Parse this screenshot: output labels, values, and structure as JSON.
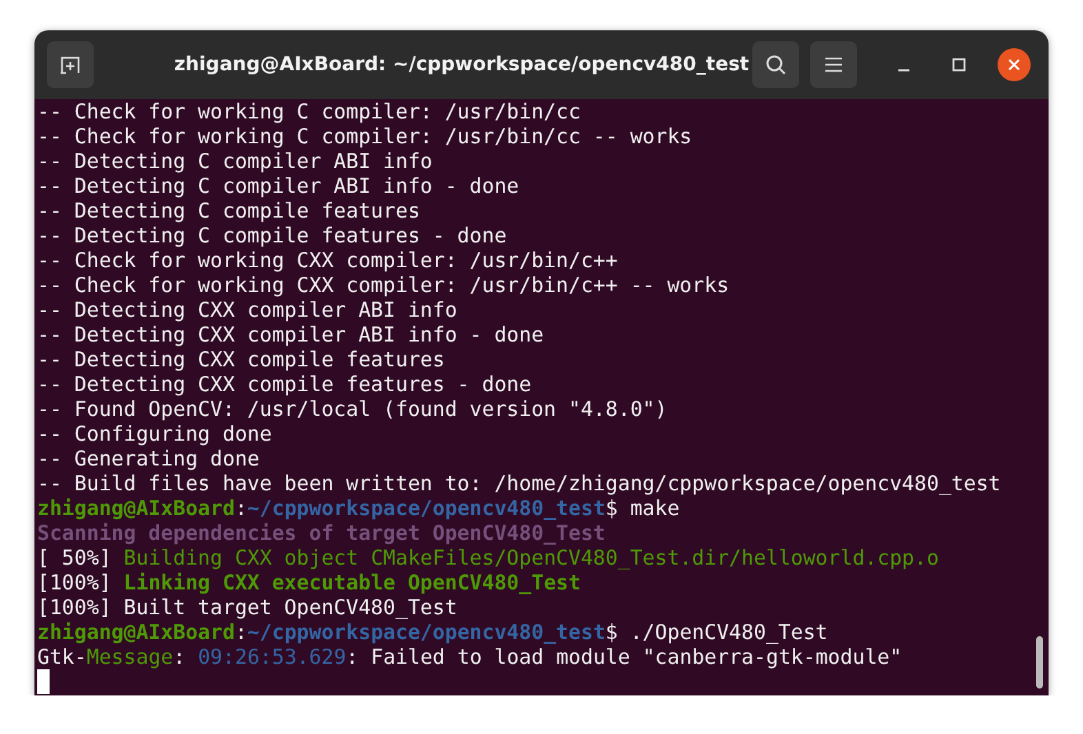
{
  "window": {
    "title": "zhigang@AIxBoard: ~/cppworkspace/opencv480_test"
  },
  "terminal": {
    "lines": [
      {
        "segments": [
          {
            "kind": "plain",
            "text": "-- Check for working C compiler: /usr/bin/cc"
          }
        ]
      },
      {
        "segments": [
          {
            "kind": "plain",
            "text": "-- Check for working C compiler: /usr/bin/cc -- works"
          }
        ]
      },
      {
        "segments": [
          {
            "kind": "plain",
            "text": "-- Detecting C compiler ABI info"
          }
        ]
      },
      {
        "segments": [
          {
            "kind": "plain",
            "text": "-- Detecting C compiler ABI info - done"
          }
        ]
      },
      {
        "segments": [
          {
            "kind": "plain",
            "text": "-- Detecting C compile features"
          }
        ]
      },
      {
        "segments": [
          {
            "kind": "plain",
            "text": "-- Detecting C compile features - done"
          }
        ]
      },
      {
        "segments": [
          {
            "kind": "plain",
            "text": "-- Check for working CXX compiler: /usr/bin/c++"
          }
        ]
      },
      {
        "segments": [
          {
            "kind": "plain",
            "text": "-- Check for working CXX compiler: /usr/bin/c++ -- works"
          }
        ]
      },
      {
        "segments": [
          {
            "kind": "plain",
            "text": "-- Detecting CXX compiler ABI info"
          }
        ]
      },
      {
        "segments": [
          {
            "kind": "plain",
            "text": "-- Detecting CXX compiler ABI info - done"
          }
        ]
      },
      {
        "segments": [
          {
            "kind": "plain",
            "text": "-- Detecting CXX compile features"
          }
        ]
      },
      {
        "segments": [
          {
            "kind": "plain",
            "text": "-- Detecting CXX compile features - done"
          }
        ]
      },
      {
        "segments": [
          {
            "kind": "plain",
            "text": "-- Found OpenCV: /usr/local (found version \"4.8.0\")"
          }
        ]
      },
      {
        "segments": [
          {
            "kind": "plain",
            "text": "-- Configuring done"
          }
        ]
      },
      {
        "segments": [
          {
            "kind": "plain",
            "text": "-- Generating done"
          }
        ]
      },
      {
        "segments": [
          {
            "kind": "plain",
            "text": "-- Build files have been written to: /home/zhigang/cppworkspace/opencv480_test"
          }
        ]
      },
      {
        "segments": [
          {
            "kind": "prompt_user",
            "text": "zhigang@AIxBoard"
          },
          {
            "kind": "plain",
            "text": ":"
          },
          {
            "kind": "prompt_path",
            "text": "~/cppworkspace/opencv480_test"
          },
          {
            "kind": "plain",
            "text": "$ make"
          }
        ]
      },
      {
        "segments": [
          {
            "kind": "dim",
            "text": "Scanning dependencies of target OpenCV480_Test"
          }
        ]
      },
      {
        "segments": [
          {
            "kind": "plain",
            "text": "[ 50%] "
          },
          {
            "kind": "green",
            "text": "Building CXX object CMakeFiles/OpenCV480_Test.dir/helloworld.cpp.o"
          }
        ]
      },
      {
        "segments": [
          {
            "kind": "plain",
            "text": "[100%] "
          },
          {
            "kind": "green_bold",
            "text": "Linking CXX executable OpenCV480_Test"
          }
        ]
      },
      {
        "segments": [
          {
            "kind": "plain",
            "text": "[100%] Built target OpenCV480_Test"
          }
        ]
      },
      {
        "segments": [
          {
            "kind": "prompt_user",
            "text": "zhigang@AIxBoard"
          },
          {
            "kind": "plain",
            "text": ":"
          },
          {
            "kind": "prompt_path",
            "text": "~/cppworkspace/opencv480_test"
          },
          {
            "kind": "plain",
            "text": "$ ./OpenCV480_Test"
          }
        ]
      },
      {
        "segments": [
          {
            "kind": "plain",
            "text": "Gtk-"
          },
          {
            "kind": "green",
            "text": "Message"
          },
          {
            "kind": "plain",
            "text": ": "
          },
          {
            "kind": "timestamp",
            "text": "09:26:53.629"
          },
          {
            "kind": "plain",
            "text": ": Failed to load module \"canberra-gtk-module\""
          }
        ]
      }
    ]
  }
}
